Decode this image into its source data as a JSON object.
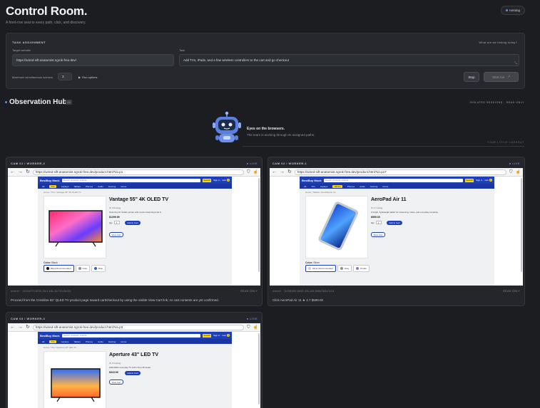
{
  "header": {
    "title": "Control Room.",
    "subtitle": "A front-row seat to every path, click, and discovery.",
    "status": "running"
  },
  "task": {
    "section_label": "Task assignment",
    "help_link": "What are we testing today?",
    "target_label": "Target website",
    "target_value": "https://wired-sift-anatomist.ngrok-free.dev/",
    "task_label": "Task",
    "task_value": "Add TVs, iPads, and a few wireless controllers to the cart and go checkout",
    "workers_label": "Maximum simultaneous workers",
    "workers_value": "3",
    "run_options": "Run options",
    "stop_label": "Stop",
    "start_label": "Start run"
  },
  "hub": {
    "title": "Observation Hub",
    "badge": "03",
    "isolated": "Isolated sessions · read only",
    "eyes_title": "Eyes on the browsers.",
    "eyes_sub": "The team is working through its assigned paths.",
    "lookout": "Your little lookout"
  },
  "site": {
    "logo": "BestBuy Mock",
    "search_placeholder": "Search products, brands...",
    "search_btn": "Search",
    "signin": "Sign in",
    "cart": "Cart",
    "cart_count": "0",
    "nav": [
      "All",
      "TVs",
      "Laptops",
      "Tablets",
      "Phones",
      "Audio",
      "Gaming",
      "Home"
    ],
    "qty_label": "Qty",
    "qty_value": "1",
    "add_to_cart": "Add to Cart",
    "view_cart": "View Cart",
    "color_label": "Color:"
  },
  "cams": [
    {
      "label": "CAM 01 / WORKER-2",
      "live": "LIVE",
      "url": "https://wired-sift-anatomist.ngrok-free.dev/product.html?id=p1",
      "active_nav": "TVs",
      "crumb": "Home / TVs / Vantage 55\" 4K OLED TV",
      "product": "Vantage 55\" 4K OLED TV",
      "rating": "★ 4.8 rating",
      "desc": "Stunning 4K OLED picture with smart streaming built in.",
      "price": "$1299.99",
      "color_value": "Black",
      "swatches": [
        {
          "name": "Black Recommended",
          "color": "#111111"
        },
        {
          "name": "Gray",
          "color": "#8a8f99"
        },
        {
          "name": "Blue",
          "color": "#2f5fd0"
        }
      ],
      "worker_id": "worker · 1152c070-800f-4fc1-b6c-8c7f1c2b31f",
      "read_only": "READ ONLY",
      "message": "Proceed from the Crestline 65\" QLED TV product page toward cart/checkout by using the visible View Cart link; no cart contents are yet confirmed."
    },
    {
      "label": "CAM 02 / WORKER-1",
      "live": "LIVE",
      "url": "https://wired-sift-anatomist.ngrok-free.dev/product.html?id=p17",
      "active_nav": "Tablets",
      "crumb": "Home / Tablets / AeroPad Air 11",
      "product": "AeroPad Air 11",
      "rating": "★ 4.7 rating",
      "desc": "A bright, lightweight tablet for streaming, notes, and everyday creativity.",
      "price": "$599.00",
      "color_value": "Silver",
      "swatches": [
        {
          "name": "Silver Recommended",
          "color": "#c9ccd2"
        },
        {
          "name": "Gray",
          "color": "#8a8f99"
        },
        {
          "name": "Purple",
          "color": "#9b6fd6"
        }
      ],
      "worker_id": "worker · 1b2f8590-6b08-4fb-a5f-9b6d2b5c0c1d",
      "read_only": "READ ONLY",
      "message": "Click AeroPad Air 11 ★ 4.7 $599.00"
    },
    {
      "label": "CAM 03 / WORKER-3",
      "live": "LIVE",
      "url": "https://wired-sift-anatomist.ngrok-free.dev/product.html?id=p3",
      "active_nav": "TVs",
      "crumb": "Home / TVs / Aperture 43\" LED TV",
      "product": "Aperture 43\" LED TV",
      "rating": "★ 4.5 rating",
      "desc": "Affordable everyday TV with crisp HD detail.",
      "price": "$319.99",
      "color_value": "",
      "swatches": [],
      "worker_id": "",
      "read_only": "",
      "message": ""
    }
  ],
  "colors": {
    "accent": "#5b8cff",
    "site_blue": "#1f3fb8",
    "site_yellow": "#ffd60a"
  }
}
